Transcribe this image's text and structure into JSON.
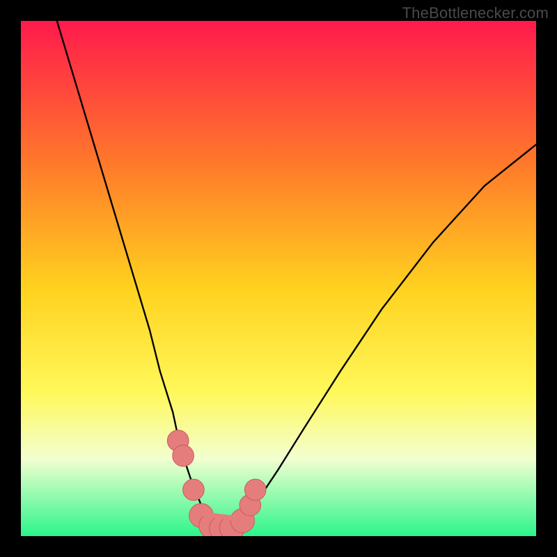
{
  "watermark": "TheBottlenecker.com",
  "colors": {
    "frame": "#000000",
    "grad_top": "#ff1a4c",
    "grad_mid1": "#ff7a2a",
    "grad_mid2": "#ffd21f",
    "grad_mid3": "#fff85a",
    "grad_mid4": "#f2ffd0",
    "grad_bottom": "#2cf58a",
    "curve": "#000000",
    "marker_fill": "#e67d7d",
    "marker_stroke": "#c95b5b"
  },
  "chart_data": {
    "type": "line",
    "title": "",
    "xlabel": "",
    "ylabel": "",
    "xlim": [
      0,
      100
    ],
    "ylim": [
      0,
      100
    ],
    "gradient_stops": [
      {
        "offset": 0.0,
        "percent": 100
      },
      {
        "offset": 0.28,
        "percent": 72
      },
      {
        "offset": 0.52,
        "percent": 48
      },
      {
        "offset": 0.72,
        "percent": 28
      },
      {
        "offset": 0.85,
        "percent": 15
      },
      {
        "offset": 1.0,
        "percent": 0
      }
    ],
    "series": [
      {
        "name": "bottleneck-curve",
        "x": [
          7,
          10,
          13,
          16,
          19,
          22,
          25,
          27,
          29.5,
          31,
          33,
          35,
          37,
          39,
          41,
          43,
          46,
          50,
          55,
          62,
          70,
          80,
          90,
          100
        ],
        "values": [
          100,
          90,
          80,
          70,
          60,
          50,
          40,
          32,
          24,
          17,
          11,
          6,
          3,
          1.5,
          1.5,
          3,
          7,
          13,
          21,
          32,
          44,
          57,
          68,
          76
        ]
      }
    ],
    "markers": [
      {
        "x": 30.5,
        "y": 18.5,
        "r": 1.4
      },
      {
        "x": 31.5,
        "y": 15.6,
        "r": 1.4
      },
      {
        "x": 33.5,
        "y": 9.0,
        "r": 1.4
      },
      {
        "x": 35.0,
        "y": 4.0,
        "r": 1.7
      },
      {
        "x": 37.0,
        "y": 2.0,
        "r": 1.8
      },
      {
        "x": 39.0,
        "y": 1.5,
        "r": 1.8
      },
      {
        "x": 41.0,
        "y": 1.6,
        "r": 1.8
      },
      {
        "x": 43.0,
        "y": 3.0,
        "r": 1.7
      },
      {
        "x": 44.5,
        "y": 6.0,
        "r": 1.4
      },
      {
        "x": 45.5,
        "y": 9.0,
        "r": 1.4
      }
    ]
  }
}
